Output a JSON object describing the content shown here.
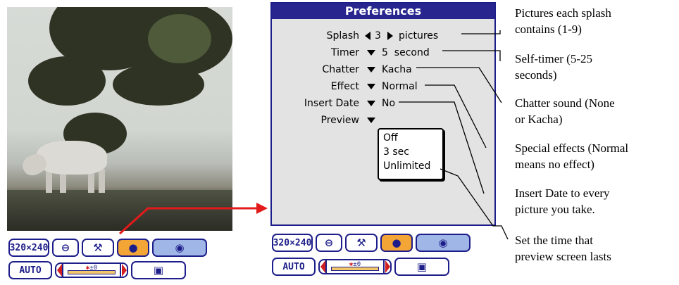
{
  "dialog": {
    "title": "Preferences",
    "rows": [
      {
        "label": "Splash",
        "value": "3",
        "suffix": "pictures"
      },
      {
        "label": "Timer",
        "value": "5  second"
      },
      {
        "label": "Chatter",
        "value": "Kacha"
      },
      {
        "label": "Effect",
        "value": "Normal"
      },
      {
        "label": "Insert Date",
        "value": "No"
      },
      {
        "label": "Preview",
        "value": ""
      }
    ],
    "preview_options": [
      "Off",
      "3 sec",
      "Unlimited"
    ]
  },
  "toolbar": {
    "resolution": "320×240",
    "mode": "AUTO",
    "exposure": "±0"
  },
  "annotations": [
    [
      "Pictures each splash",
      "contains (1-9)"
    ],
    [
      "Self-timer (5-25",
      "seconds)"
    ],
    [
      "Chatter sound (None",
      "or Kacha)"
    ],
    [
      "Special effects (Normal",
      "means no effect)"
    ],
    [
      "Insert Date to every",
      "picture you take."
    ],
    [
      "Set the time that",
      "preview screen lasts"
    ]
  ],
  "icons": {
    "zoom": "zoom-out-icon",
    "tools": "settings-tools-icon",
    "self": "self-portrait-icon",
    "eye": "eye-icon",
    "camera": "camera-icon",
    "arrow": "red-arrow"
  },
  "colors": {
    "frame_blue": "#1e1e8a",
    "title_bar": "#28268e",
    "arrow_red": "#e21a1a",
    "self_button": "#f3a536",
    "eye_button": "#9fb6e6"
  }
}
